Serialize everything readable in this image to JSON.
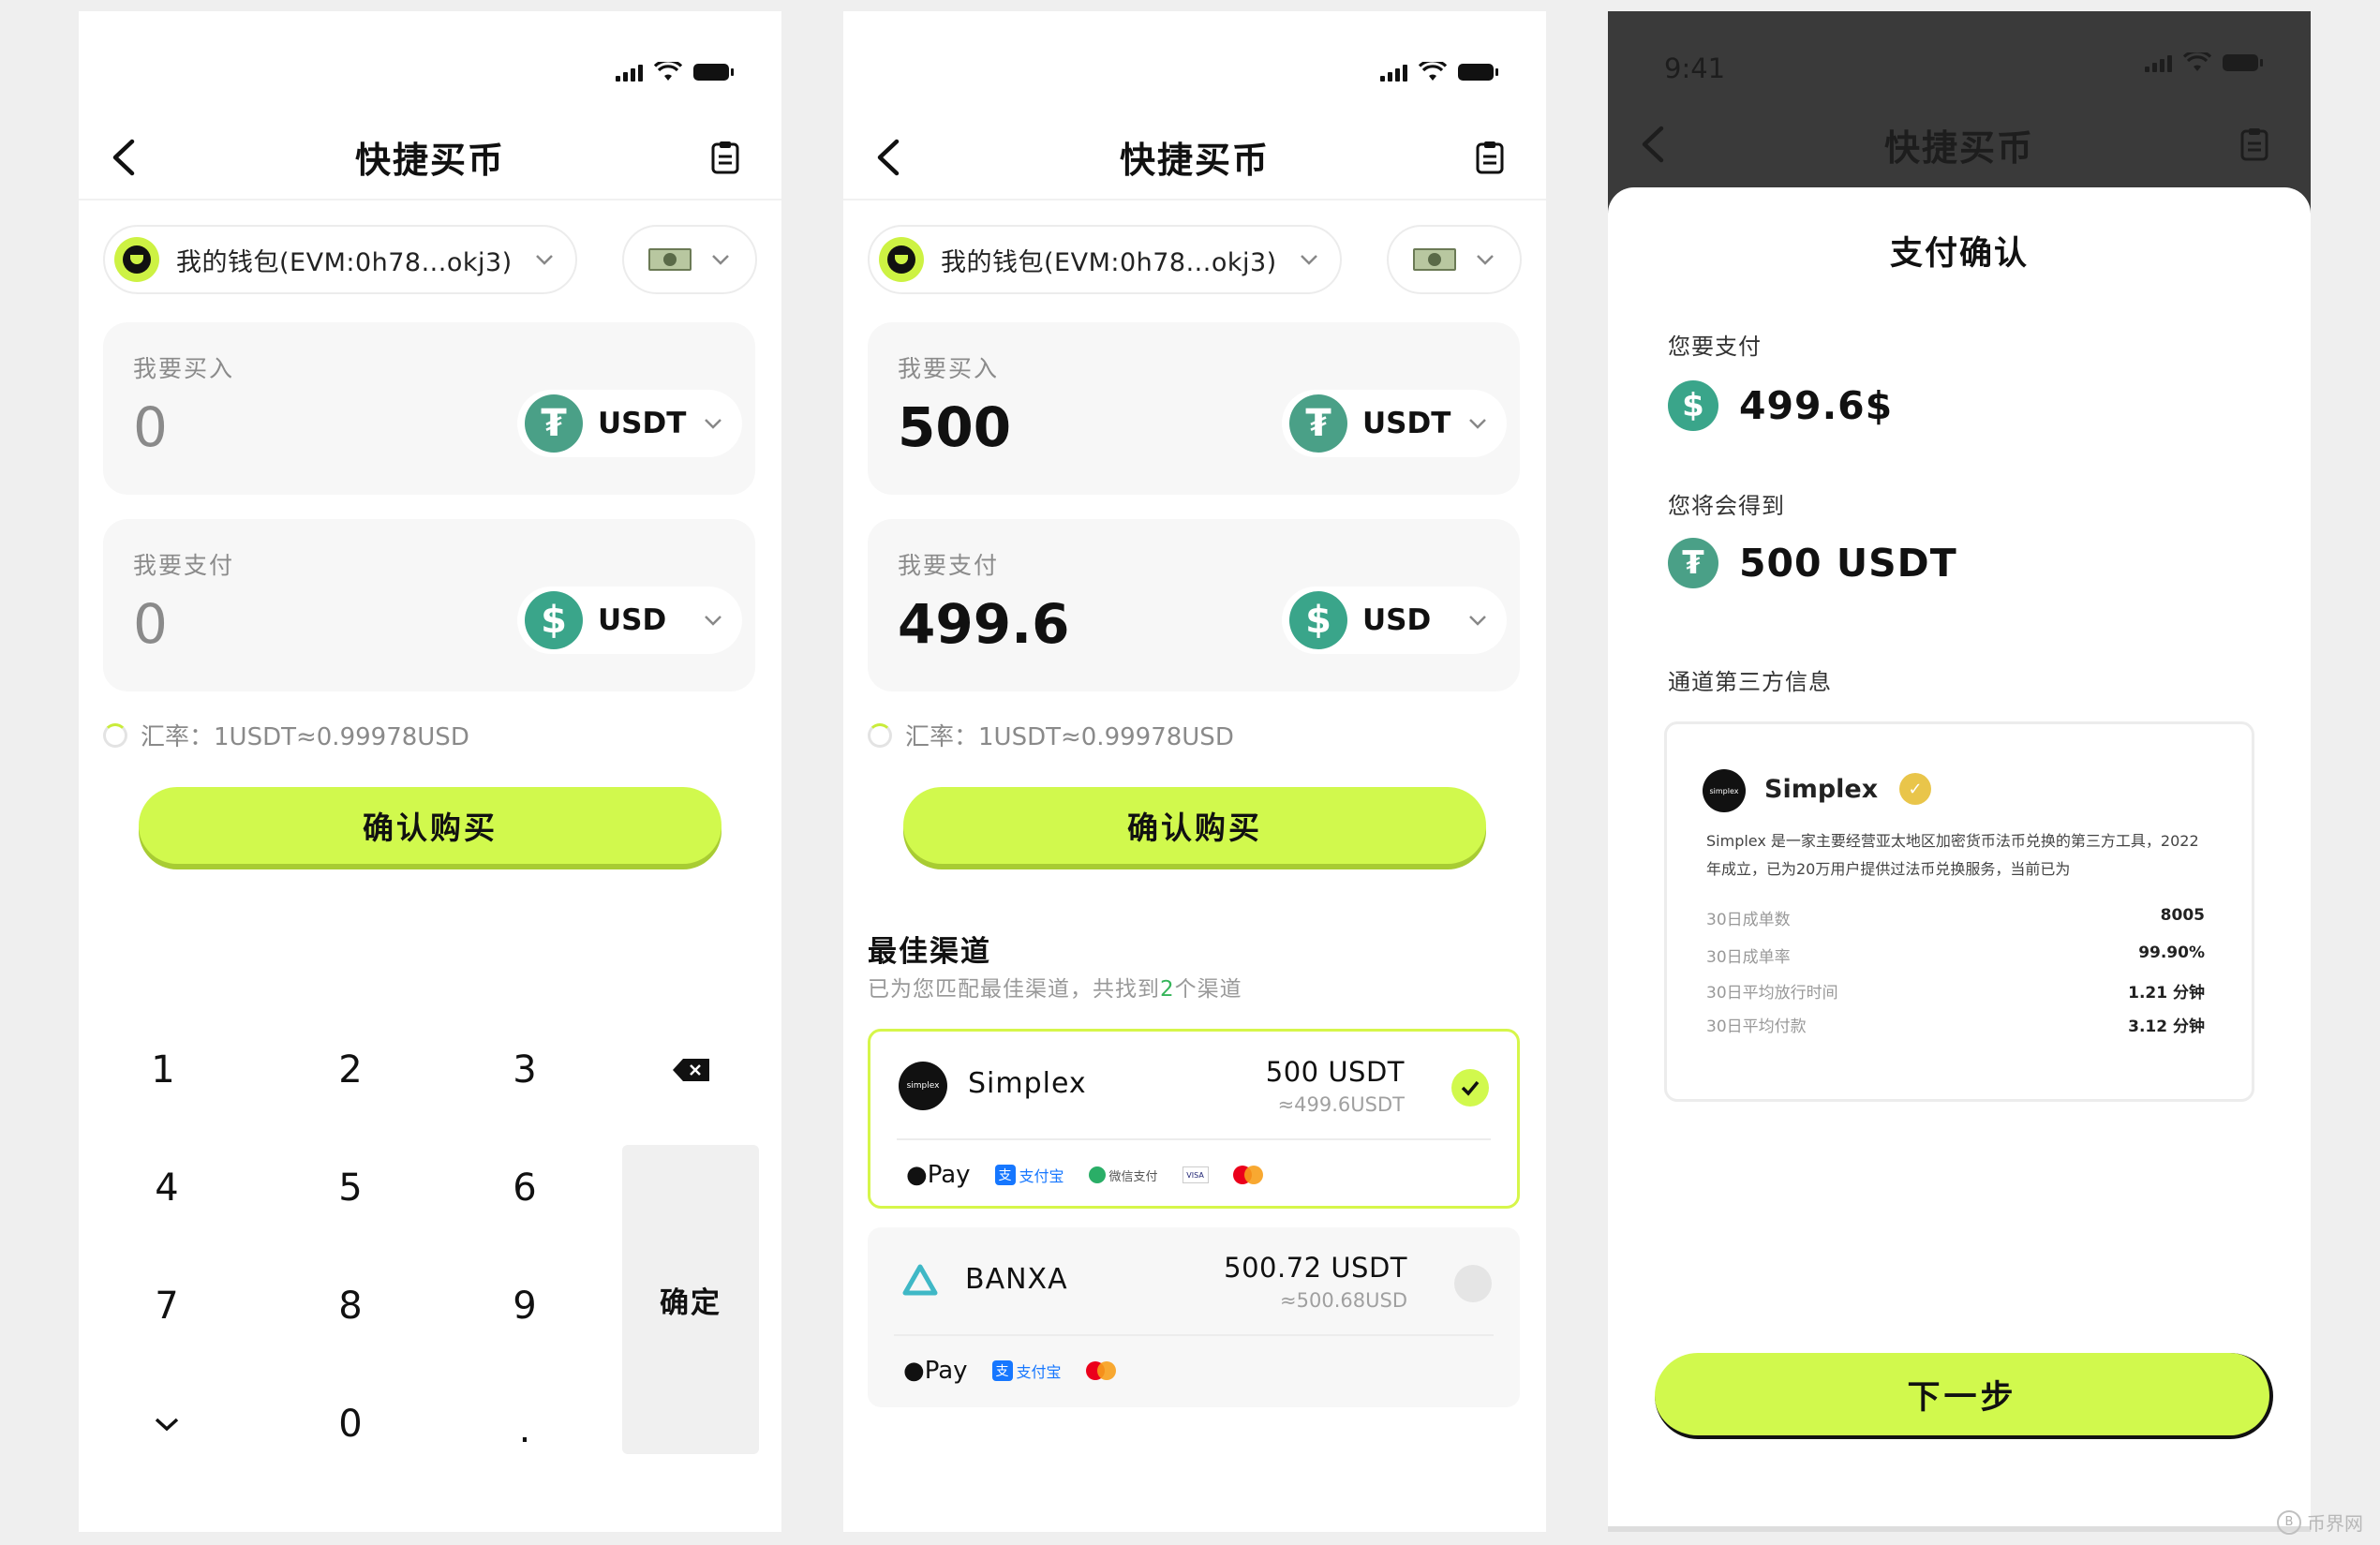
{
  "colors": {
    "accent": "#d1f94d",
    "tether": "#4aa087",
    "dollar": "#3aa58a",
    "highlight": "#36b55a"
  },
  "screens": [
    {
      "nav_title": "快捷买币",
      "wallet_label": "我的钱包(EVM:0h78...okj3)",
      "buy_label": "我要买入",
      "buy_value": "0",
      "buy_token": "USDT",
      "pay_label": "我要支付",
      "pay_value": "0",
      "pay_token": "USD",
      "rate": "汇率：1USDT≈0.99978USD",
      "confirm_label": "确认购买",
      "keypad": {
        "k1": "1",
        "k2": "2",
        "k3": "3",
        "k4": "4",
        "k5": "5",
        "k6": "6",
        "k7": "7",
        "k8": "8",
        "k9": "9",
        "k0": "0",
        "dot": ".",
        "confirm": "确定"
      }
    },
    {
      "nav_title": "快捷买币",
      "wallet_label": "我的钱包(EVM:0h78...okj3)",
      "buy_label": "我要买入",
      "buy_value": "500",
      "buy_token": "USDT",
      "pay_label": "我要支付",
      "pay_value": "499.6",
      "pay_token": "USD",
      "rate": "汇率：1USDT≈0.99978USD",
      "confirm_label": "确认购买",
      "best_title": "最佳渠道",
      "best_sub_prefix": "已为您匹配最佳渠道，共找到",
      "best_sub_count": "2",
      "best_sub_suffix": "个渠道",
      "channels": [
        {
          "name": "Simplex",
          "logo_text": "simplex",
          "amount": "500 USDT",
          "approx": "≈499.6USDT",
          "selected": true,
          "apple_pay": "Pay",
          "alipay": "支付宝",
          "wechat": "微信支付",
          "visa": "VISA"
        },
        {
          "name": "BANXA",
          "amount": "500.72 USDT",
          "approx": "≈500.68USD",
          "selected": false,
          "apple_pay": "Pay",
          "alipay": "支付宝"
        }
      ]
    },
    {
      "time": "9:41",
      "nav_title": "快捷买币",
      "sheet_title": "支付确认",
      "pay_label": "您要支付",
      "pay_value": "499.6$",
      "get_label": "您将会得到",
      "get_value": "500 USDT",
      "third_party_label": "通道第三方信息",
      "provider": {
        "name": "Simplex",
        "logo_text": "simplex",
        "description": "Simplex 是一家主要经营亚太地区加密货币法币兑换的第三方工具，2022年成立，已为20万用户提供过法币兑换服务，当前已为",
        "stats": [
          {
            "label": "30日成单数",
            "value": "8005"
          },
          {
            "label": "30日成单率",
            "value": "99.90%"
          },
          {
            "label": "30日平均放行时间",
            "value": "1.21 分钟"
          },
          {
            "label": "30日平均付款",
            "value": "3.12 分钟"
          }
        ]
      },
      "next_label": "下一步"
    }
  ],
  "watermark": "币界网"
}
